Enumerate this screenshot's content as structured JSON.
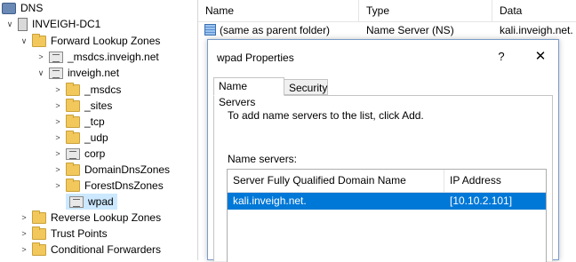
{
  "tree": {
    "items": [
      {
        "label": "DNS",
        "toggle": "",
        "icon": "dns-root-icon"
      },
      {
        "label": "INVEIGH-DC1",
        "toggle": "∨",
        "icon": "server-icon"
      },
      {
        "label": "Forward Lookup Zones",
        "toggle": "∨",
        "icon": "folder-icon"
      },
      {
        "label": "_msdcs.inveigh.net",
        "toggle": ">",
        "icon": "zone-icon"
      },
      {
        "label": "inveigh.net",
        "toggle": "∨",
        "icon": "zone-icon"
      },
      {
        "label": "_msdcs",
        "toggle": ">",
        "icon": "folder-icon"
      },
      {
        "label": "_sites",
        "toggle": ">",
        "icon": "folder-icon"
      },
      {
        "label": "_tcp",
        "toggle": ">",
        "icon": "folder-icon"
      },
      {
        "label": "_udp",
        "toggle": ">",
        "icon": "folder-icon"
      },
      {
        "label": "corp",
        "toggle": ">",
        "icon": "zone-icon"
      },
      {
        "label": "DomainDnsZones",
        "toggle": ">",
        "icon": "folder-icon"
      },
      {
        "label": "ForestDnsZones",
        "toggle": ">",
        "icon": "folder-icon"
      },
      {
        "label": "wpad",
        "toggle": "",
        "icon": "zone-icon"
      },
      {
        "label": "Reverse Lookup Zones",
        "toggle": ">",
        "icon": "folder-icon"
      },
      {
        "label": "Trust Points",
        "toggle": ">",
        "icon": "folder-icon"
      },
      {
        "label": "Conditional Forwarders",
        "toggle": ">",
        "icon": "folder-icon"
      }
    ]
  },
  "list": {
    "headers": {
      "name": "Name",
      "type": "Type",
      "data": "Data"
    },
    "rows": [
      {
        "name": "(same as parent folder)",
        "type": "Name Server (NS)",
        "data": "kali.inveigh.net."
      }
    ]
  },
  "dialog": {
    "title": "wpad Properties",
    "help": "?",
    "close": "✕",
    "tabs": [
      {
        "label": "Name Servers"
      },
      {
        "label": "Security"
      }
    ],
    "instruction": "To add name servers to the list, click Add.",
    "ns_label": "Name servers:",
    "ns_headers": {
      "fqdn": "Server Fully Qualified Domain Name (FQDN)",
      "ip": "IP Address"
    },
    "ns_rows": [
      {
        "fqdn": "kali.inveigh.net.",
        "ip": "[10.10.2.101]"
      }
    ]
  },
  "colors": {
    "selection": "#0078d7",
    "tree_selection": "#cce8ff",
    "folder": "#f2c75c"
  }
}
